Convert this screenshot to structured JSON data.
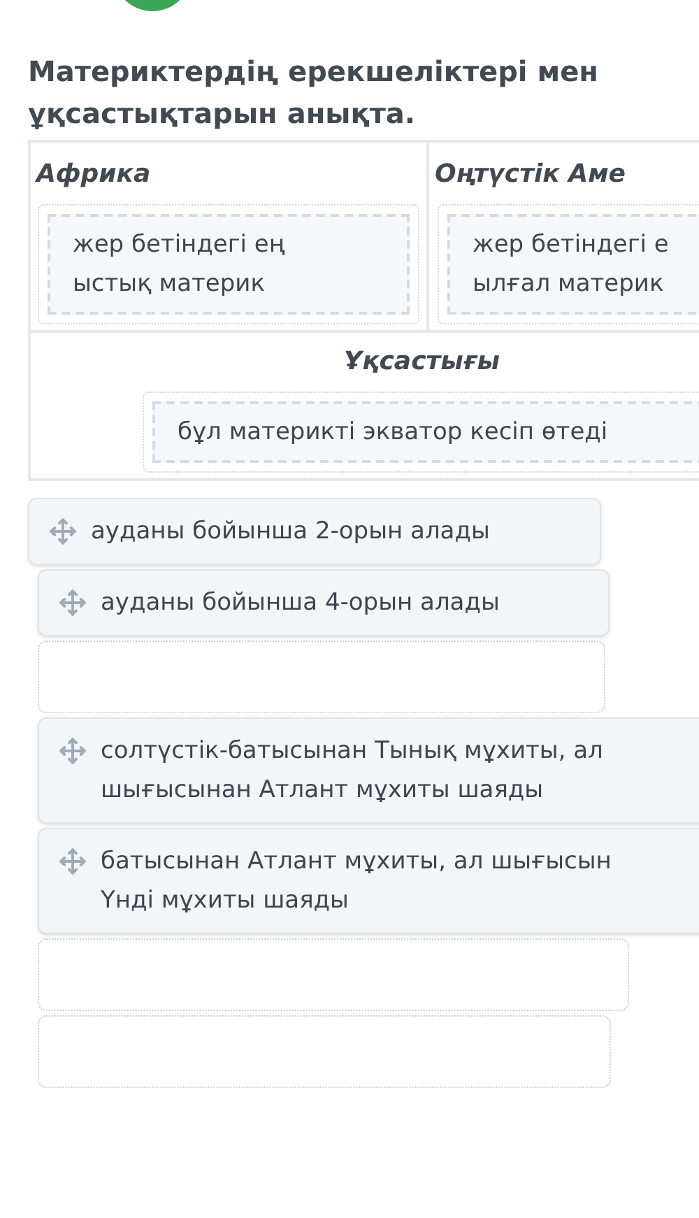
{
  "title": "Материктердің ерекшеліктері мен ұқсастықтарын анықта.",
  "table": {
    "columns": [
      {
        "heading": "Африка",
        "answer": {
          "lines": [
            "жер бетіндегі ең",
            "ыстық материк"
          ]
        }
      },
      {
        "heading": "Оңтүстік Аме",
        "answer": {
          "lines": [
            "жер бетіндегі е",
            "ылғал материк"
          ]
        }
      }
    ],
    "shared": {
      "heading": "Ұқсастығы",
      "answer": {
        "lines": [
          "бұл материкті экватор кесіп өтеді"
        ]
      }
    }
  },
  "pool": [
    {
      "kind": "card",
      "lines": [
        "ауданы бойынша 2-орын алады"
      ]
    },
    {
      "kind": "card",
      "lines": [
        "ауданы бойынша 4-орын алады"
      ]
    },
    {
      "kind": "slot"
    },
    {
      "kind": "card",
      "lines": [
        "солтүстік-батысынан Тынық мұхиты, ал",
        "шығысынан Атлант мұхиты шаяды"
      ]
    },
    {
      "kind": "card",
      "lines": [
        "батысынан Атлант мұхиты, ал шығысын",
        "Үнді мұхиты шаяды"
      ]
    },
    {
      "kind": "slot"
    },
    {
      "kind": "slot"
    }
  ]
}
